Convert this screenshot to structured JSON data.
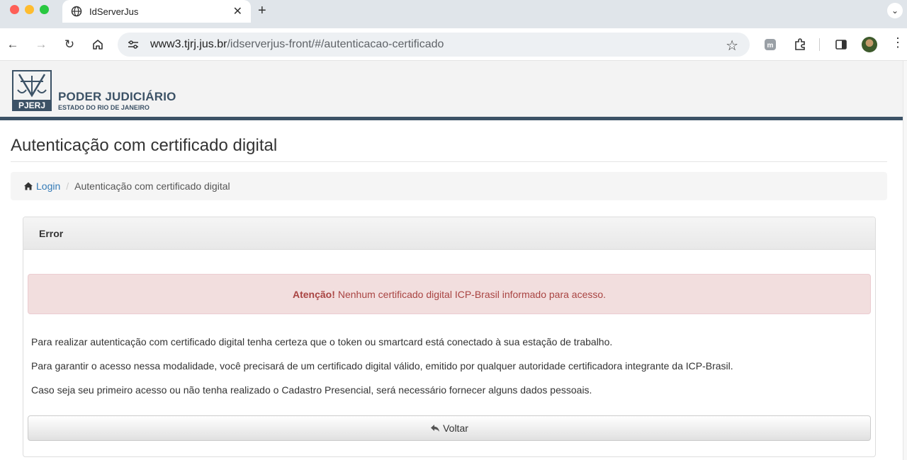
{
  "browser": {
    "tab_title": "IdServerJus",
    "tab_close": "✕",
    "new_tab": "+",
    "url_host": "www3.tjrj.jus.br",
    "url_path": "/idserverjus-front/#/autenticacao-certificado"
  },
  "brand": {
    "logo_text": "PJERJ",
    "title": "PODER JUDICIÁRIO",
    "subtitle": "ESTADO DO RIO DE JANEIRO",
    "primary_color": "#3c5266"
  },
  "page": {
    "heading": "Autenticação com certificado digital",
    "breadcrumb": {
      "login": "Login",
      "separator": "/",
      "current": "Autenticação com certificado digital"
    },
    "panel": {
      "heading": "Error",
      "alert": {
        "strong": "Atenção!",
        "message": "Nenhum certificado digital ICP-Brasil informado para acesso.",
        "color": "#a94442"
      },
      "paragraphs": [
        "Para realizar autenticação com certificado digital tenha certeza que o token ou smartcard está conectado à sua estação de trabalho.",
        "Para garantir o acesso nessa modalidade, você precisará de um certificado digital válido, emitido por qualquer autoridade certificadora integrante da ICP-Brasil.",
        "Caso seja seu primeiro acesso ou não tenha realizado o Cadastro Presencial, será necessário fornecer alguns dados pessoais."
      ],
      "back_button": "Voltar"
    }
  },
  "colors": {
    "link": "#337ab7",
    "alert_bg": "#f2dede"
  }
}
